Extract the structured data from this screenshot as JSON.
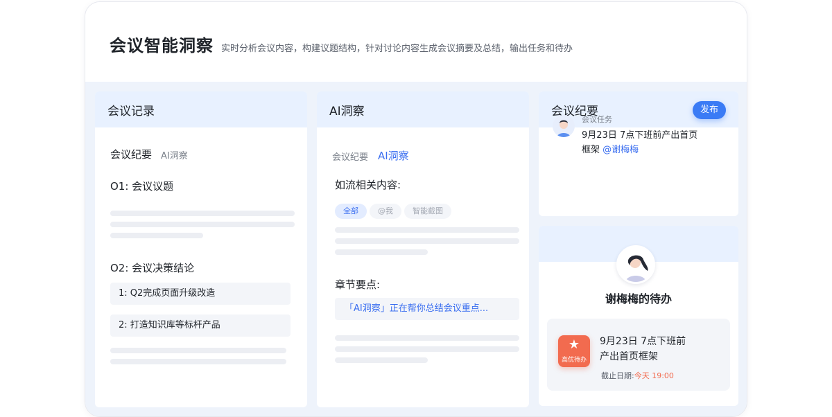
{
  "header": {
    "title": "会议智能洞察",
    "subtitle": "实时分析会议内容，构建议题结构，针对讨论内容生成会议摘要及总结，输出任务和待办"
  },
  "records": {
    "title": "会议记录",
    "tab_active": "会议纪要",
    "tab_inactive": "AI洞察",
    "section1": "O1: 会议议题",
    "section2": "O2: 会议决策结论",
    "items": [
      "1: Q2完成页面升级改造",
      "2: 打造知识库等标杆产品"
    ]
  },
  "insight": {
    "title": "AI洞察",
    "tab_inactive": "会议纪要",
    "tab_active": "AI洞察",
    "related_label": "如流相关内容:",
    "filters": [
      "全部",
      "@我",
      "智能截图"
    ],
    "chapter_label": "章节要点:",
    "status_text": "「AI洞察」正在帮你总结会议重点..."
  },
  "minutes": {
    "title": "会议纪要",
    "publish": "发布",
    "task_label": "会议任务",
    "task_line1": "9月23日 7点下班前产出首页",
    "task_line2": "框架",
    "mention": "@谢梅梅"
  },
  "todo": {
    "owner_title": "谢梅梅的待办",
    "badge_label": "高优待办",
    "badge_icon": "star-icon",
    "task_line1": "9月23日 7点下班前",
    "task_line2": "产出首页框架",
    "deadline_label": "截止日期:",
    "deadline_value": "今天 19:00"
  },
  "colors": {
    "accent": "#3a7bf5",
    "urgent": "#f26b4f",
    "header_band": "#e8f1ff",
    "background": "#eef3fb"
  }
}
